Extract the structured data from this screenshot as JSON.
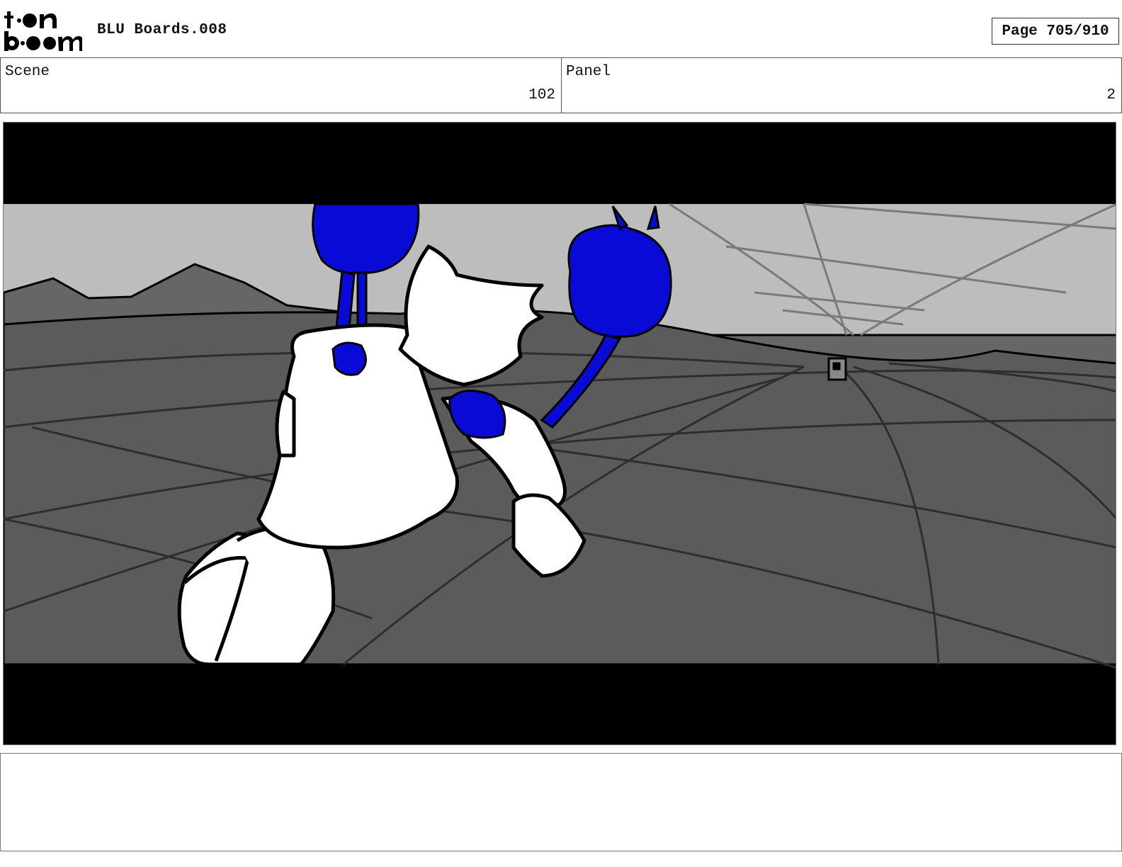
{
  "header": {
    "logo_text": "toon boom",
    "title": "BLU Boards.008",
    "page": "Page 705/910"
  },
  "scene": {
    "label": "Scene",
    "value": "102"
  },
  "panel": {
    "label": "Panel",
    "value": "2"
  },
  "notes": {
    "text": ""
  },
  "colors": {
    "ink": "#000000",
    "sky": "#bdbdbd",
    "ground": "#5b5b5b",
    "hills": "#666666",
    "flame_blue": "#0a0ad6"
  }
}
